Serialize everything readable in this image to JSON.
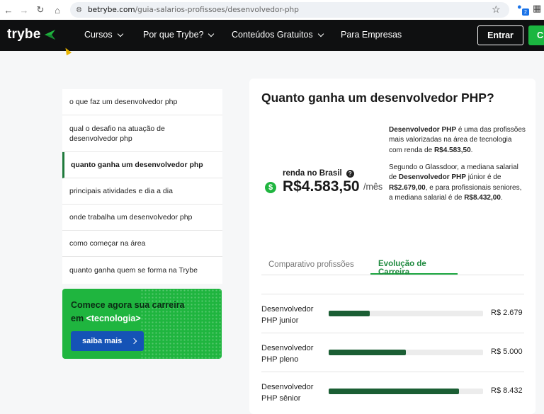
{
  "browser": {
    "url_host": "betrybe.com",
    "url_path": "/guia-salarios-profissoes/desenvolvedor-php",
    "extension_badge": "2"
  },
  "header": {
    "logo": "trybe",
    "menu": [
      {
        "label": "Cursos",
        "has_dropdown": true
      },
      {
        "label": "Por que Trybe?",
        "has_dropdown": true
      },
      {
        "label": "Conteúdos Gratuitos",
        "has_dropdown": true
      },
      {
        "label": "Para Empresas",
        "has_dropdown": false
      }
    ],
    "login_label": "Entrar",
    "cta_label_cut": "C"
  },
  "sidenav": {
    "items": [
      {
        "label": "o que faz um desenvolvedor php",
        "active": false
      },
      {
        "label": "qual o desafio na atuação de desenvolvedor php",
        "active": false
      },
      {
        "label": "quanto ganha um desenvolvedor php",
        "active": true
      },
      {
        "label": "principais atividades e dia a dia",
        "active": false
      },
      {
        "label": "onde trabalha um desenvolvedor php",
        "active": false
      },
      {
        "label": "como começar na área",
        "active": false
      },
      {
        "label": "quanto ganha quem se forma na Trybe",
        "active": false
      }
    ]
  },
  "cta": {
    "line1": "Comece agora sua carreira",
    "line2_prefix": "em ",
    "line2_highlight": "<tecnologia>",
    "button_label": "saiba mais"
  },
  "main": {
    "title": "Quanto ganha um desenvolvedor PHP?",
    "income_label": "renda no Brasil",
    "income_value": "R$4.583,50",
    "income_unit": "/mês",
    "desc1": {
      "b1": "Desenvolvedor PHP",
      "t1": " é uma das profissões mais valorizadas na área de tecnologia com renda de ",
      "b2": "R$4.583,50",
      "t2": "."
    },
    "desc2": {
      "t1": "Segundo o Glassdoor, a mediana salarial de ",
      "b1": "Desenvolvedor PHP",
      "t2": " júnior é de ",
      "b2": "R$2.679,00",
      "t3": ", e para profissionais seniores, a mediana salarial é de ",
      "b3": "R$8.432,00",
      "t4": "."
    },
    "tabs": [
      {
        "label": "Comparativo profissões",
        "active": false
      },
      {
        "label": "Evolução de Carreira",
        "active": true
      }
    ],
    "career": [
      {
        "label_l1": "Desenvolvedor",
        "label_l2": "PHP junior",
        "value_text": "R$ 2.679",
        "value": 2679
      },
      {
        "label_l1": "Desenvolvedor",
        "label_l2": "PHP pleno",
        "value_text": "R$ 5.000",
        "value": 5000
      },
      {
        "label_l1": "Desenvolvedor",
        "label_l2": "PHP sênior",
        "value_text": "R$ 8.432",
        "value": 8432
      }
    ],
    "career_max": 10000
  },
  "colors": {
    "brand_green": "#1fb53f",
    "dark_green": "#1b5e34",
    "header_bg": "#0f1011",
    "cta_button": "#1553b6"
  }
}
